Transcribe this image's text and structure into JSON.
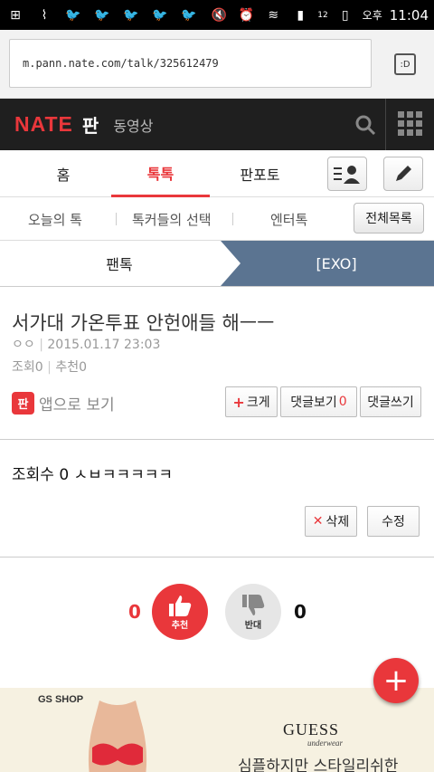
{
  "status": {
    "time": "11:04",
    "ampm": "오후",
    "battery": "12"
  },
  "url": {
    "text": "m.pann.nate.com/talk/325612479",
    "btn": ":D"
  },
  "header": {
    "logo": "NATE",
    "pan": "판",
    "video": "동영상"
  },
  "tabs": [
    "홈",
    "톡톡",
    "판포토"
  ],
  "subtabs": {
    "items": [
      "오늘의 톡",
      "톡커들의 선택",
      "엔터톡"
    ],
    "all": "전체목록"
  },
  "crumb": {
    "left": "팬톡",
    "right": "[EXO]"
  },
  "post": {
    "title": "서가대 가온투표 안헌애들 해ㅡㅡ",
    "author": "ㅇㅇ",
    "date": "2015.01.17 23:03",
    "views_label": "조회",
    "views": "0",
    "recommend_label": "추천",
    "recommend": "0",
    "app_icon": "판",
    "app_view": "앱으로 보기",
    "btn_big": "크게",
    "btn_comments": "댓글보기",
    "comments": "0",
    "btn_write": "댓글쓰기"
  },
  "body": {
    "text": "조회수 0 ㅅㅂㅋㅋㅋㅋㅋ",
    "delete": "삭제",
    "edit": "수정"
  },
  "vote": {
    "up_count": "0",
    "up_label": "추천",
    "down_count": "0",
    "down_label": "반대"
  },
  "ad": {
    "brand": "GS SHOP",
    "guess": "GUESS",
    "underwear": "underwear",
    "tagline": "심플하지만 스타일리쉬한"
  },
  "colors": {
    "accent": "#e9373b",
    "crumb": "#5b7491",
    "header": "#1f1f1f"
  }
}
